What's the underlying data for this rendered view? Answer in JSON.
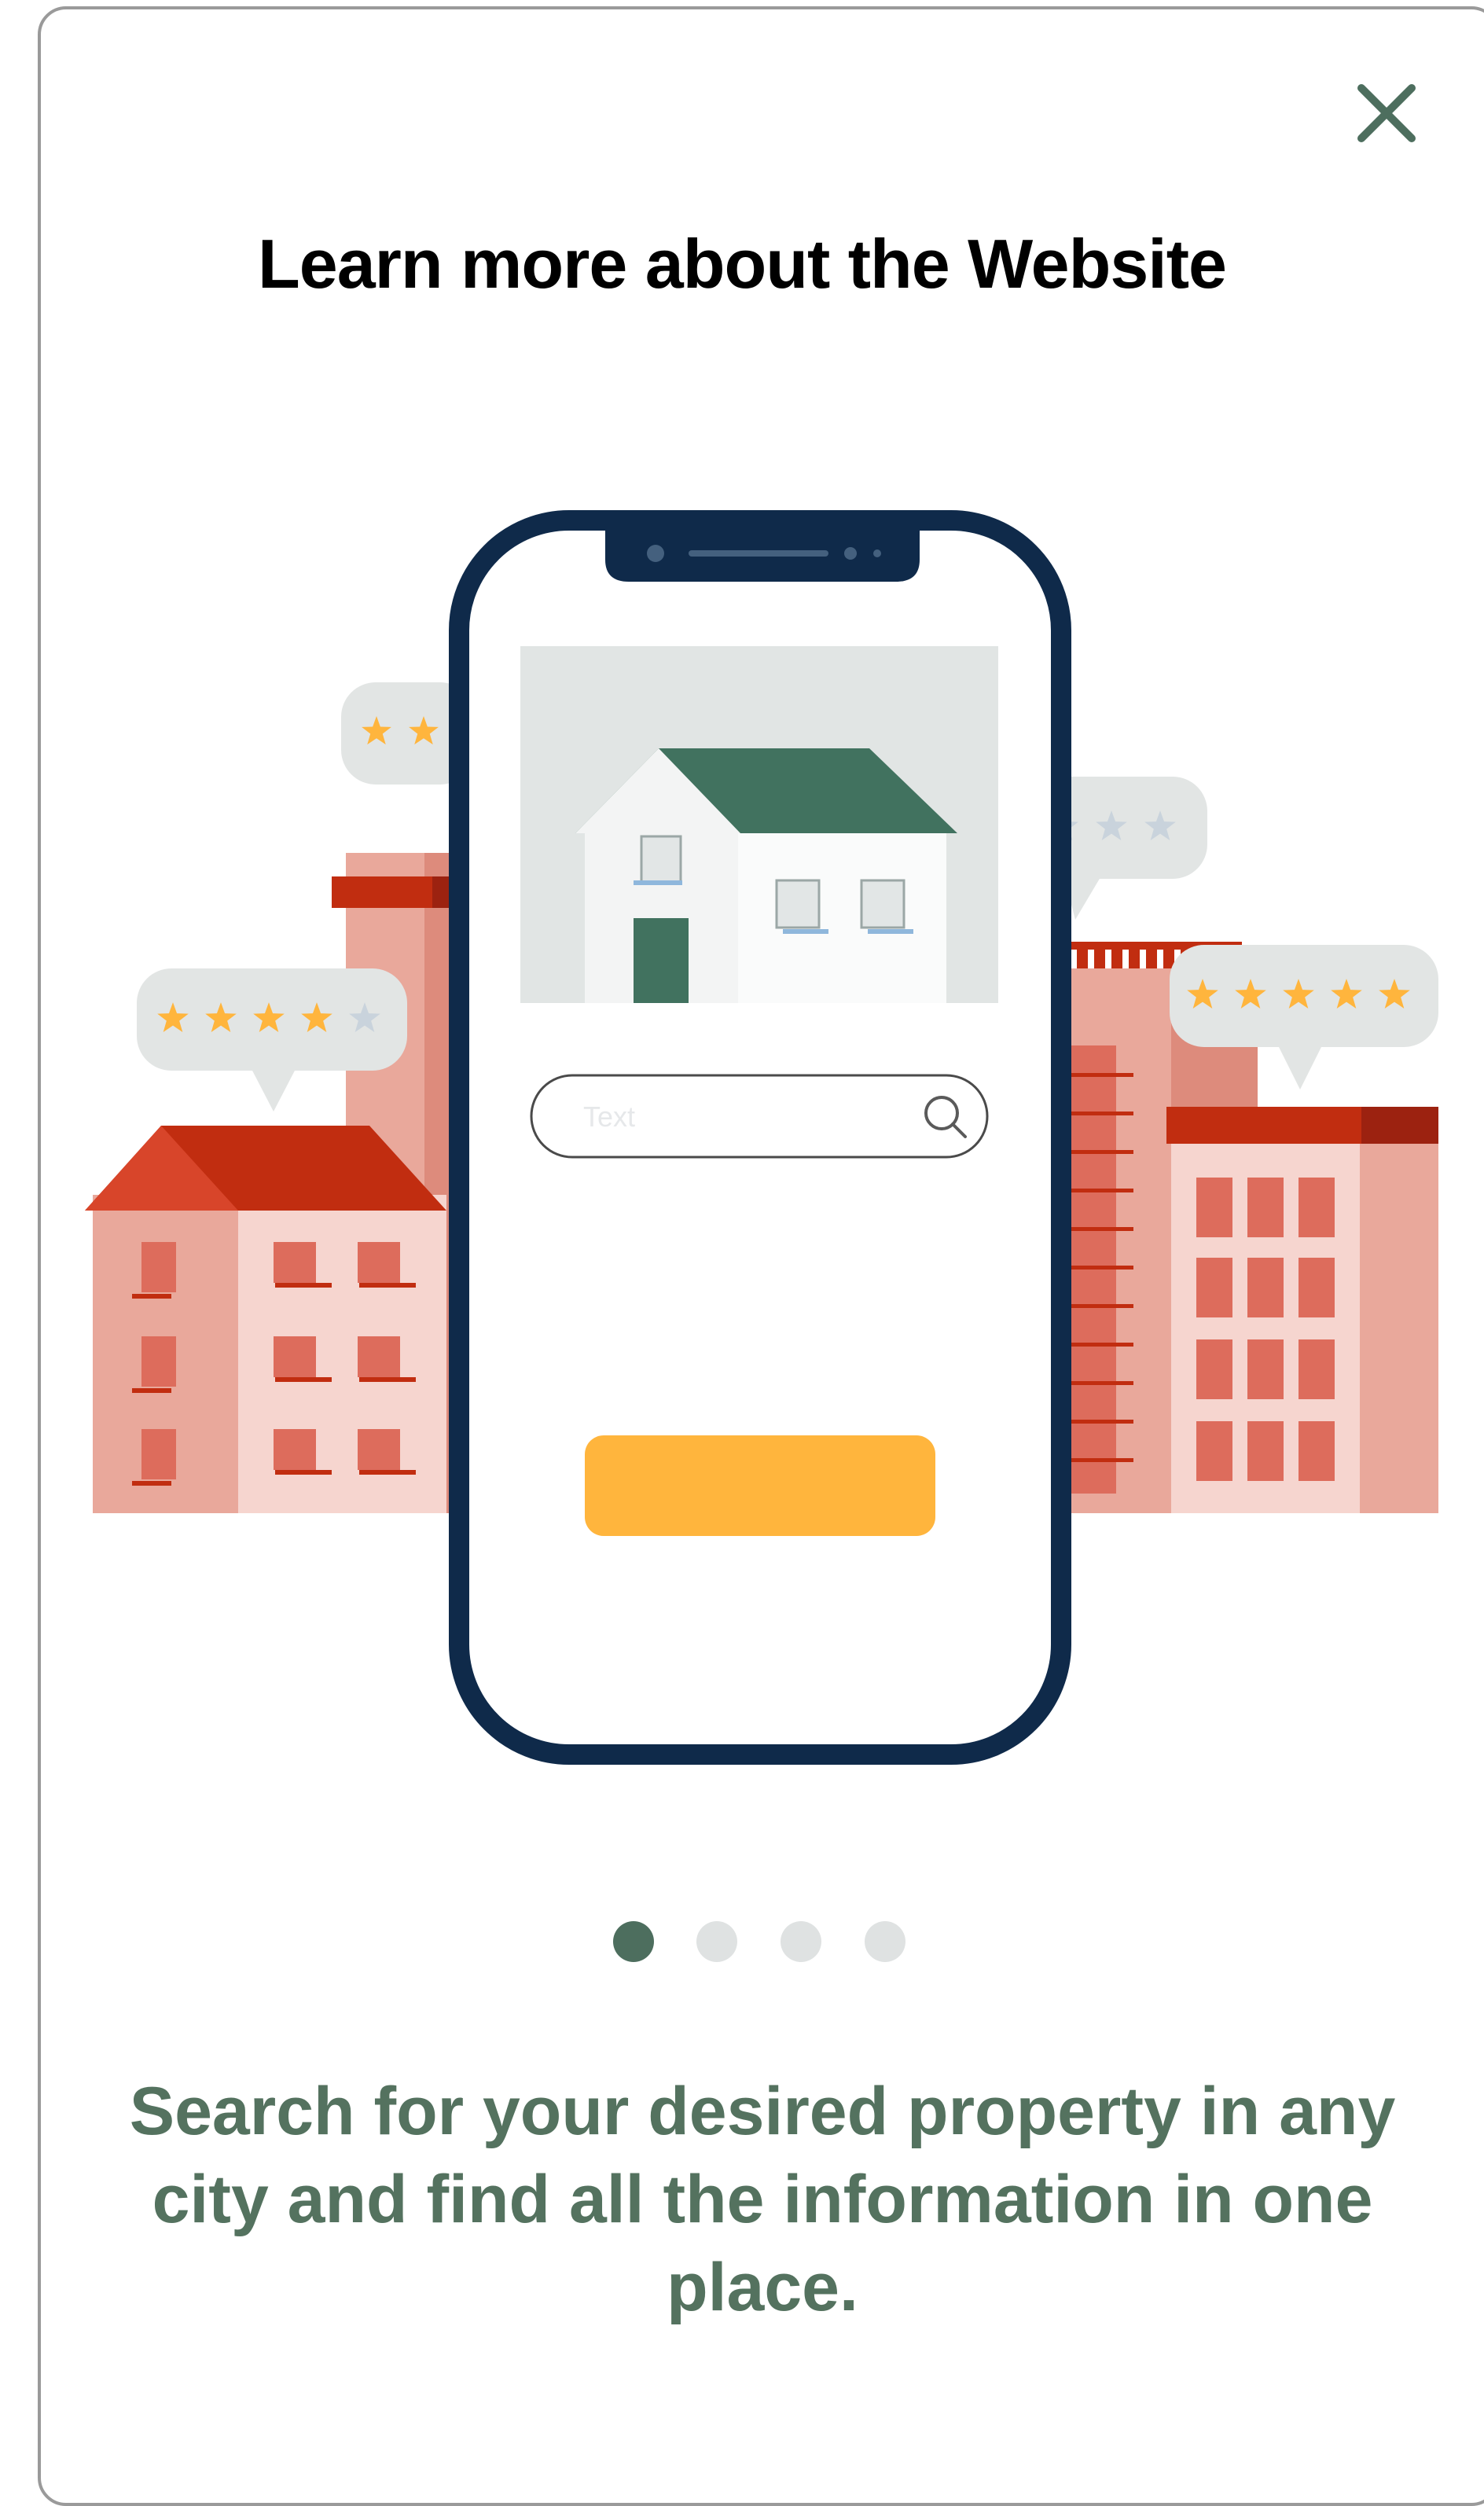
{
  "modal": {
    "title": "Learn more about the Website",
    "close_icon": "close-icon",
    "description": "Search for your desired property in any city and find all the information in one place."
  },
  "illustration": {
    "search_placeholder": "Text",
    "search_icon": "search-icon",
    "ratings": [
      {
        "filled": 2,
        "total": 2
      },
      {
        "filled": 4,
        "total": 5
      },
      {
        "filled": 0,
        "total": 3
      },
      {
        "filled": 5,
        "total": 5
      }
    ]
  },
  "carousel": {
    "current": 1,
    "total": 4
  },
  "colors": {
    "accent": "#4d6e5e",
    "text_green": "#54725f",
    "phone_frame": "#0f2a4a",
    "cta_button": "#ffb53d",
    "roof_red": "#c12d10",
    "star": "#ffb53d"
  }
}
